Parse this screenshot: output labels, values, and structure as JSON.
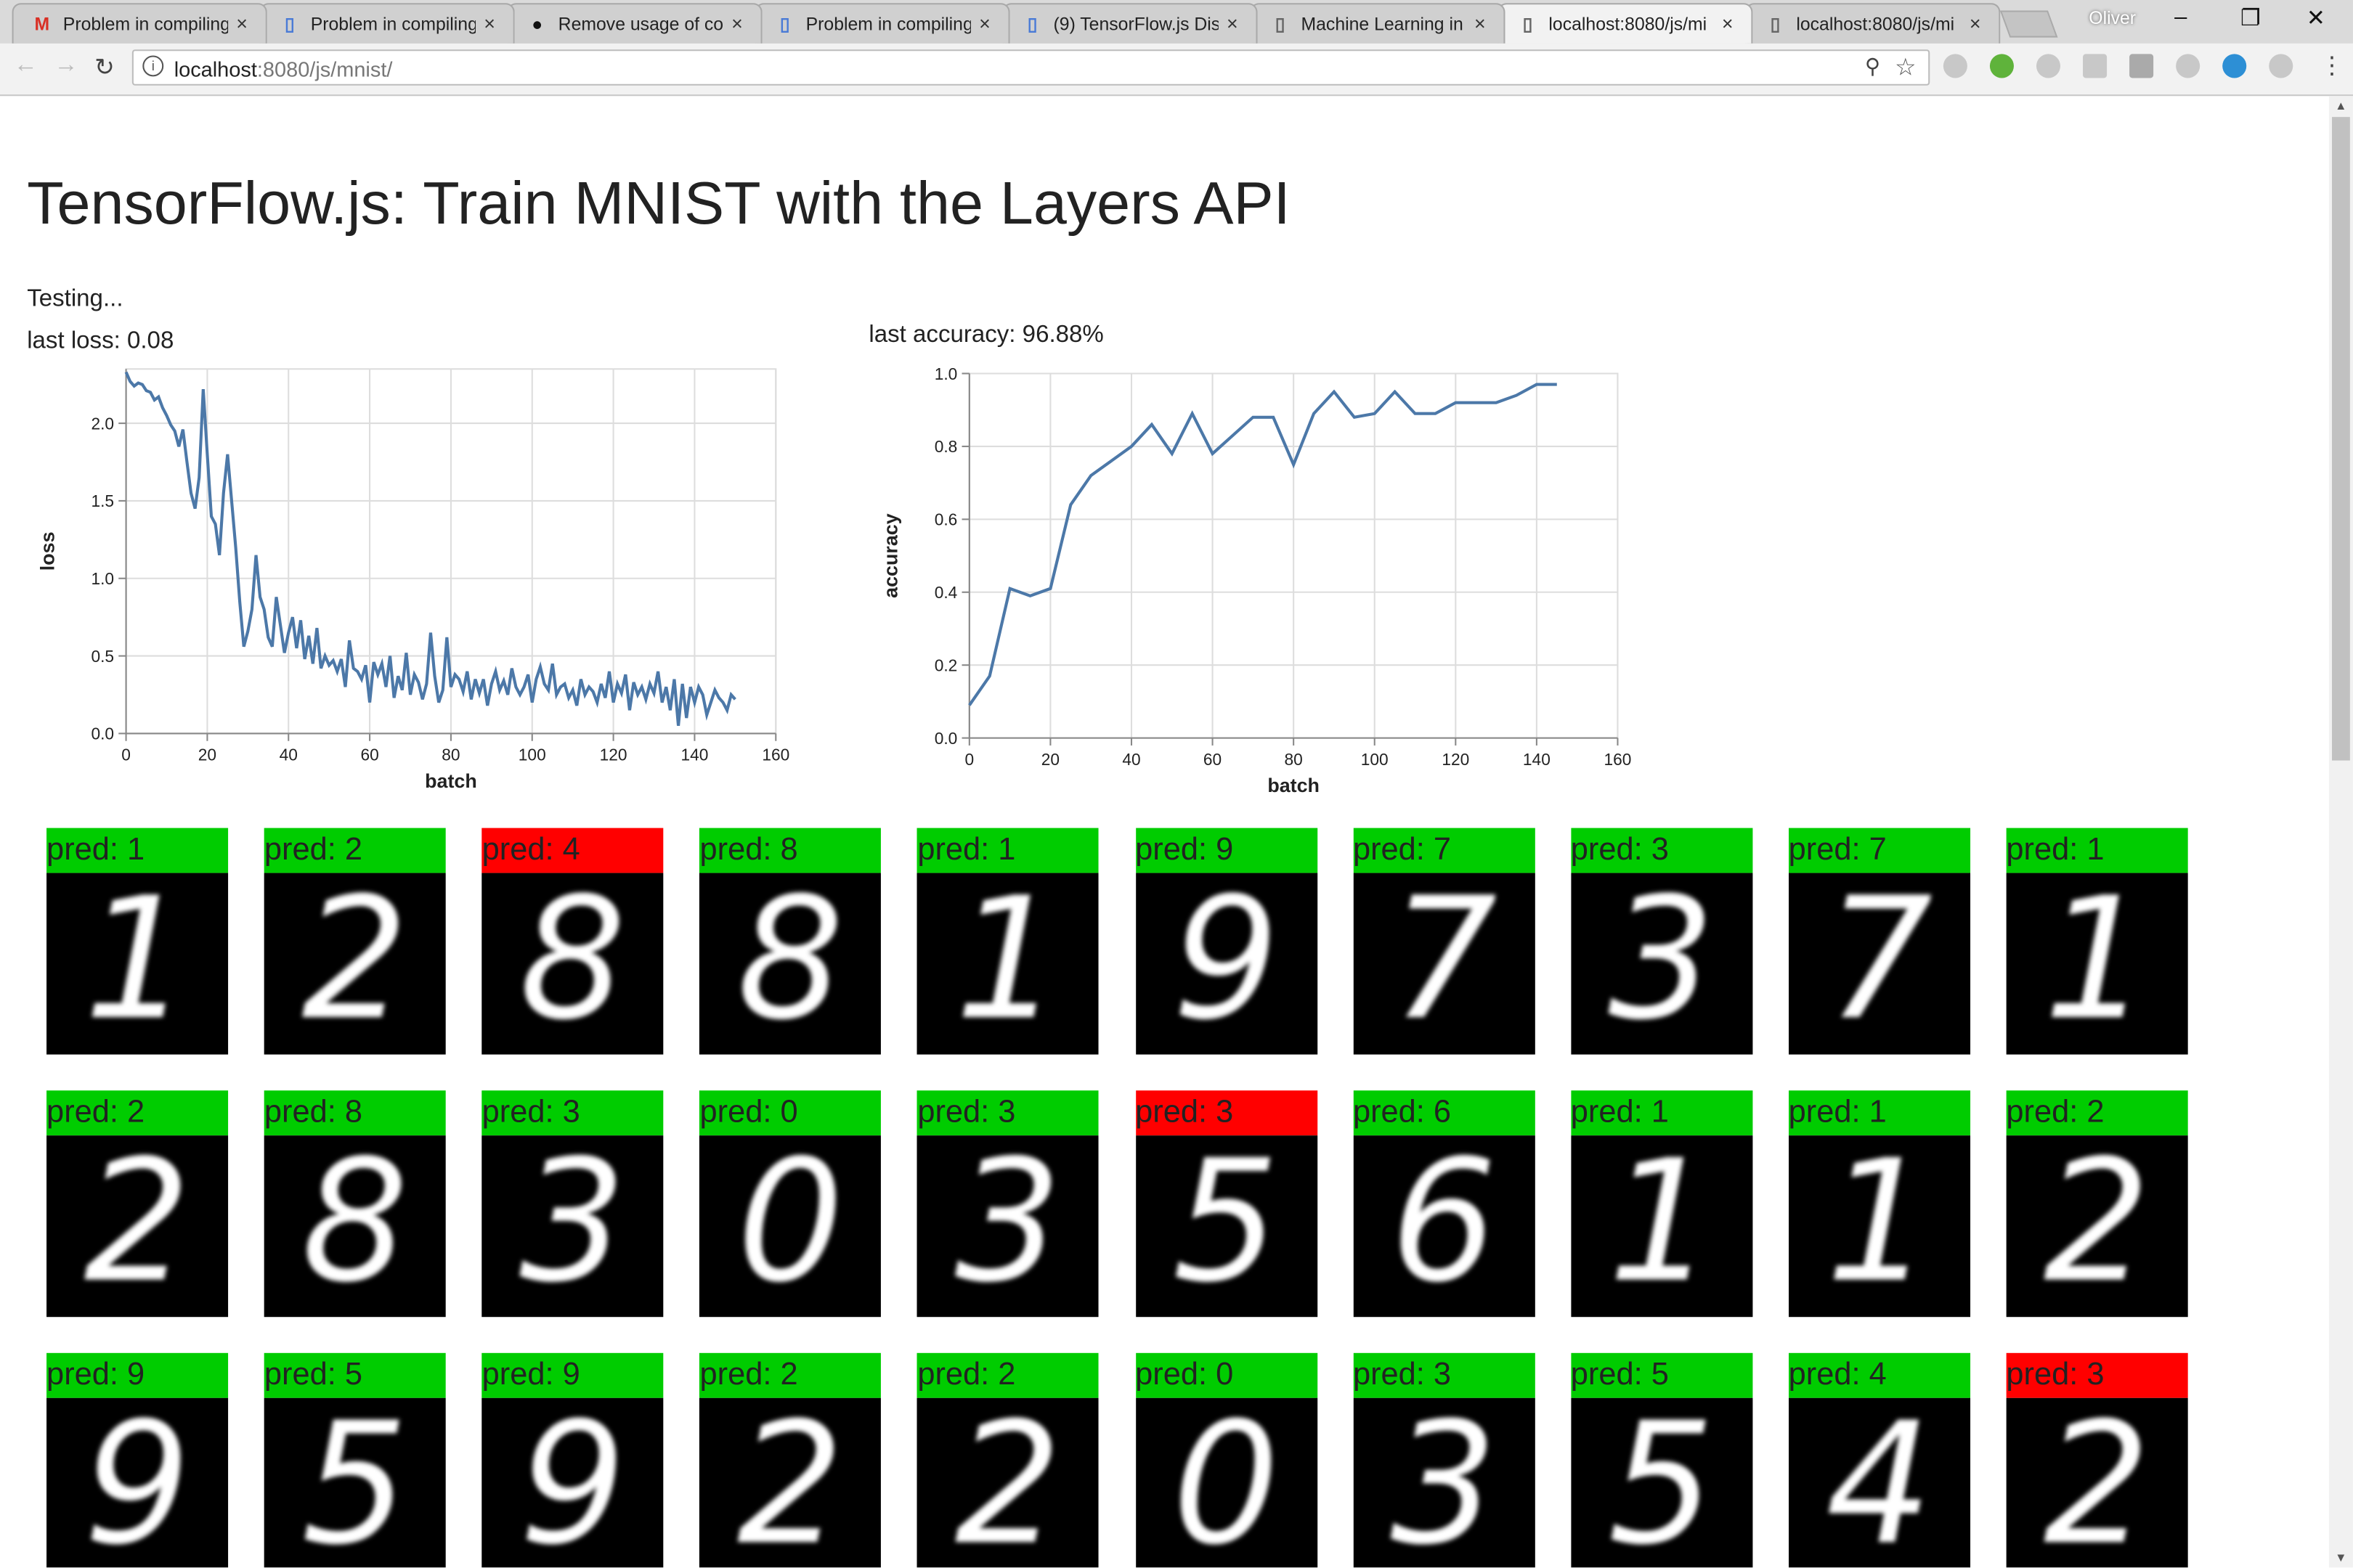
{
  "browser": {
    "tabs": [
      {
        "icon": "gmail-icon",
        "title": "Problem in compiling",
        "close": "×",
        "active": false,
        "color": "#d93025"
      },
      {
        "icon": "google-groups-icon",
        "title": "Problem in compiling",
        "close": "×",
        "active": false,
        "color": "#4a7bd6"
      },
      {
        "icon": "github-icon",
        "title": "Remove usage of co",
        "close": "×",
        "active": false,
        "color": "#111111"
      },
      {
        "icon": "google-groups-icon",
        "title": "Problem in compiling",
        "close": "×",
        "active": false,
        "color": "#4a7bd6"
      },
      {
        "icon": "google-groups-icon",
        "title": "(9) TensorFlow.js Dis",
        "close": "×",
        "active": false,
        "color": "#4a7bd6"
      },
      {
        "icon": "page-icon",
        "title": "Machine Learning in",
        "close": "×",
        "active": false,
        "color": "#666666"
      },
      {
        "icon": "page-icon",
        "title": "localhost:8080/js/mi",
        "close": "×",
        "active": true,
        "color": "#666666"
      },
      {
        "icon": "page-icon",
        "title": "localhost:8080/js/mi",
        "close": "×",
        "active": false,
        "color": "#666666"
      }
    ],
    "profile": "Oliver",
    "url_host": "localhost",
    "url_rest": ":8080/js/mnist/"
  },
  "page": {
    "title": "TensorFlow.js: Train MNIST with the Layers API",
    "status": "Testing...",
    "last_loss": "last loss: 0.08",
    "last_accuracy": "last accuracy: 96.88%"
  },
  "chart_data": [
    {
      "type": "line",
      "xlabel": "batch",
      "ylabel": "loss",
      "xlim": [
        0,
        160
      ],
      "ylim": [
        0,
        2.35
      ],
      "x_ticks": [
        0,
        20,
        40,
        60,
        80,
        100,
        120,
        140,
        160
      ],
      "y_ticks": [
        0.0,
        0.5,
        1.0,
        1.5,
        2.0
      ],
      "grid": true,
      "color": "#4c78a8",
      "x": [
        0,
        1,
        2,
        3,
        4,
        5,
        6,
        7,
        8,
        9,
        10,
        11,
        12,
        13,
        14,
        15,
        16,
        17,
        18,
        19,
        20,
        21,
        22,
        23,
        24,
        25,
        26,
        27,
        28,
        29,
        30,
        31,
        32,
        33,
        34,
        35,
        36,
        37,
        38,
        39,
        40,
        41,
        42,
        43,
        44,
        45,
        46,
        47,
        48,
        49,
        50,
        51,
        52,
        53,
        54,
        55,
        56,
        57,
        58,
        59,
        60,
        61,
        62,
        63,
        64,
        65,
        66,
        67,
        68,
        69,
        70,
        71,
        72,
        73,
        74,
        75,
        76,
        77,
        78,
        79,
        80,
        81,
        82,
        83,
        84,
        85,
        86,
        87,
        88,
        89,
        90,
        91,
        92,
        93,
        94,
        95,
        96,
        97,
        98,
        99,
        100,
        101,
        102,
        103,
        104,
        105,
        106,
        107,
        108,
        109,
        110,
        111,
        112,
        113,
        114,
        115,
        116,
        117,
        118,
        119,
        120,
        121,
        122,
        123,
        124,
        125,
        126,
        127,
        128,
        129,
        130,
        131,
        132,
        133,
        134,
        135,
        136,
        137,
        138,
        139,
        140,
        141,
        142,
        143,
        144,
        145,
        146,
        147,
        148,
        149,
        150
      ],
      "y": [
        2.33,
        2.27,
        2.24,
        2.26,
        2.25,
        2.21,
        2.2,
        2.15,
        2.17,
        2.1,
        2.05,
        1.99,
        1.95,
        1.85,
        1.96,
        1.75,
        1.55,
        1.45,
        1.65,
        2.22,
        1.8,
        1.4,
        1.35,
        1.15,
        1.55,
        1.8,
        1.5,
        1.2,
        0.85,
        0.56,
        0.66,
        0.8,
        1.15,
        0.88,
        0.8,
        0.62,
        0.56,
        0.88,
        0.7,
        0.52,
        0.65,
        0.75,
        0.55,
        0.73,
        0.48,
        0.63,
        0.45,
        0.68,
        0.42,
        0.5,
        0.44,
        0.47,
        0.4,
        0.48,
        0.3,
        0.6,
        0.42,
        0.4,
        0.35,
        0.44,
        0.2,
        0.46,
        0.38,
        0.45,
        0.3,
        0.5,
        0.23,
        0.37,
        0.28,
        0.52,
        0.25,
        0.38,
        0.33,
        0.22,
        0.32,
        0.65,
        0.37,
        0.2,
        0.28,
        0.62,
        0.3,
        0.38,
        0.35,
        0.27,
        0.4,
        0.22,
        0.35,
        0.26,
        0.35,
        0.18,
        0.32,
        0.4,
        0.28,
        0.34,
        0.25,
        0.42,
        0.3,
        0.25,
        0.3,
        0.38,
        0.2,
        0.35,
        0.43,
        0.32,
        0.28,
        0.45,
        0.25,
        0.3,
        0.32,
        0.23,
        0.28,
        0.18,
        0.35,
        0.25,
        0.3,
        0.27,
        0.2,
        0.32,
        0.23,
        0.4,
        0.2,
        0.32,
        0.26,
        0.38,
        0.15,
        0.33,
        0.25,
        0.3,
        0.22,
        0.32,
        0.26,
        0.4,
        0.2,
        0.3,
        0.15,
        0.35,
        0.05,
        0.32,
        0.1,
        0.3,
        0.2,
        0.3,
        0.25,
        0.12,
        0.2,
        0.28,
        0.23,
        0.2,
        0.15,
        0.25,
        0.22,
        0.25,
        0.25,
        0.2,
        0.1,
        0.24,
        0.22,
        0.08
      ]
    },
    {
      "type": "line",
      "xlabel": "batch",
      "ylabel": "accuracy",
      "xlim": [
        0,
        160
      ],
      "ylim": [
        0,
        1.0
      ],
      "x_ticks": [
        0,
        20,
        40,
        60,
        80,
        100,
        120,
        140,
        160
      ],
      "y_ticks": [
        0.0,
        0.2,
        0.4,
        0.6,
        0.8,
        1.0
      ],
      "grid": true,
      "color": "#4c78a8",
      "x": [
        0,
        5,
        10,
        15,
        20,
        25,
        30,
        35,
        40,
        45,
        50,
        55,
        60,
        65,
        70,
        75,
        80,
        85,
        90,
        95,
        100,
        105,
        110,
        115,
        120,
        125,
        130,
        135,
        140,
        145
      ],
      "y": [
        0.09,
        0.17,
        0.41,
        0.39,
        0.41,
        0.64,
        0.72,
        0.76,
        0.8,
        0.86,
        0.78,
        0.89,
        0.78,
        0.83,
        0.88,
        0.88,
        0.75,
        0.89,
        0.95,
        0.88,
        0.89,
        0.95,
        0.89,
        0.89,
        0.92,
        0.92,
        0.92,
        0.94,
        0.97,
        0.97
      ]
    }
  ],
  "predictions": {
    "correct_color": "#00cc00",
    "wrong_color": "#ff0000",
    "items": [
      {
        "label": "pred: 1",
        "digit": "1",
        "correct": true
      },
      {
        "label": "pred: 2",
        "digit": "2",
        "correct": true
      },
      {
        "label": "pred: 4",
        "digit": "8",
        "correct": false
      },
      {
        "label": "pred: 8",
        "digit": "8",
        "correct": true
      },
      {
        "label": "pred: 1",
        "digit": "1",
        "correct": true
      },
      {
        "label": "pred: 9",
        "digit": "9",
        "correct": true
      },
      {
        "label": "pred: 7",
        "digit": "7",
        "correct": true
      },
      {
        "label": "pred: 3",
        "digit": "3",
        "correct": true
      },
      {
        "label": "pred: 7",
        "digit": "7",
        "correct": true
      },
      {
        "label": "pred: 1",
        "digit": "1",
        "correct": true
      },
      {
        "label": "pred: 2",
        "digit": "2",
        "correct": true
      },
      {
        "label": "pred: 8",
        "digit": "8",
        "correct": true
      },
      {
        "label": "pred: 3",
        "digit": "3",
        "correct": true
      },
      {
        "label": "pred: 0",
        "digit": "0",
        "correct": true
      },
      {
        "label": "pred: 3",
        "digit": "3",
        "correct": true
      },
      {
        "label": "pred: 3",
        "digit": "5",
        "correct": false
      },
      {
        "label": "pred: 6",
        "digit": "6",
        "correct": true
      },
      {
        "label": "pred: 1",
        "digit": "1",
        "correct": true
      },
      {
        "label": "pred: 1",
        "digit": "1",
        "correct": true
      },
      {
        "label": "pred: 2",
        "digit": "2",
        "correct": true
      },
      {
        "label": "pred: 9",
        "digit": "9",
        "correct": true
      },
      {
        "label": "pred: 5",
        "digit": "5",
        "correct": true
      },
      {
        "label": "pred: 9",
        "digit": "9",
        "correct": true
      },
      {
        "label": "pred: 2",
        "digit": "2",
        "correct": true
      },
      {
        "label": "pred: 2",
        "digit": "2",
        "correct": true
      },
      {
        "label": "pred: 0",
        "digit": "0",
        "correct": true
      },
      {
        "label": "pred: 3",
        "digit": "3",
        "correct": true
      },
      {
        "label": "pred: 5",
        "digit": "5",
        "correct": true
      },
      {
        "label": "pred: 4",
        "digit": "4",
        "correct": true
      },
      {
        "label": "pred: 3",
        "digit": "2",
        "correct": false
      }
    ]
  }
}
